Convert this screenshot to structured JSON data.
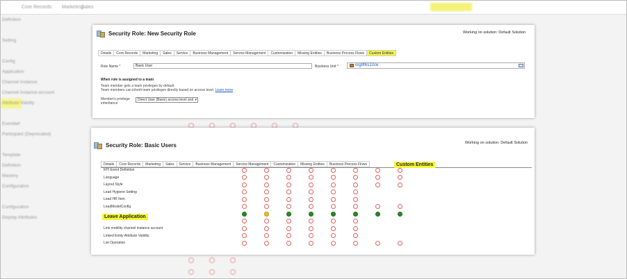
{
  "background": {
    "topbar": [
      "Core Records",
      "Marketing",
      "Sales"
    ],
    "sidebar": [
      "Definition",
      "",
      "Setting",
      "",
      "Config",
      "Application",
      "Channel Instance",
      "Channel Instance account",
      "Attribute Validity",
      "",
      "Eventdef",
      "Participant (Deprecated)",
      "",
      "Template",
      "Definition",
      "Mastery",
      "Configuration",
      "",
      "Configuration",
      "Display Attributes"
    ]
  },
  "panel1": {
    "title": "Security Role: New Security Role",
    "working": "Working on solution: Default Solution",
    "tabs": [
      {
        "label": "Details",
        "hl": false
      },
      {
        "label": "Core Records",
        "hl": false
      },
      {
        "label": "Marketing",
        "hl": false
      },
      {
        "label": "Sales",
        "hl": false
      },
      {
        "label": "Service",
        "hl": false
      },
      {
        "label": "Business Management",
        "hl": false
      },
      {
        "label": "Service Management",
        "hl": false
      },
      {
        "label": "Customization",
        "hl": false
      },
      {
        "label": "Missing Entities",
        "hl": false
      },
      {
        "label": "Business Process Flows",
        "hl": false
      },
      {
        "label": "Custom Entities",
        "hl": true
      }
    ],
    "role_name_label": "Role Name",
    "role_name_value": "Basic User",
    "business_unit_label": "Business Unit",
    "business_unit_value": "org9f6122ce",
    "team_heading": "When role is assigned to a team",
    "team_line1": "Team member gets a team privileges by default.",
    "team_line2": "Team members can inherit team privileges directly based on access level.",
    "learn_more": "Learn more",
    "inherit_label_1": "Member's privilege",
    "inherit_label_2": "inheritance",
    "inherit_value": "Direct User (Basic) access level and"
  },
  "panel2": {
    "title": "Security Role: Basic Users",
    "working": "Working on solution: Default Solution",
    "tabs": [
      "Details",
      "Core Records",
      "Marketing",
      "Sales",
      "Service",
      "Business Management",
      "Service Management",
      "Customization",
      "Missing Entities",
      "Business Process Flows"
    ],
    "rows": [
      {
        "label": "KPI Event Definition",
        "cells": [
          "none",
          "none",
          "none",
          "none",
          "none",
          "none",
          "none",
          "none"
        ]
      },
      {
        "label": "Language",
        "cells": [
          "none",
          "none",
          "none",
          "none",
          "none",
          "none",
          "none",
          "none"
        ]
      },
      {
        "label": "Layout Style",
        "cells": [
          "none",
          "none",
          "none",
          "none",
          "none",
          "none",
          "none",
          "none"
        ]
      },
      {
        "label": "Lead Hygiene Setting",
        "cells": [
          "none",
          "none",
          "none",
          "none",
          "none",
          "none",
          "",
          ""
        ]
      },
      {
        "label": "Lead HR Item",
        "cells": [
          "none",
          "none",
          "none",
          "none",
          "none",
          "none",
          "",
          ""
        ]
      },
      {
        "label": "LeadModelConfig",
        "cells": [
          "none",
          "none",
          "none",
          "none",
          "none",
          "none",
          "none",
          "none"
        ]
      },
      {
        "label": "",
        "cells": [
          "full",
          "user",
          "full",
          "full",
          "full",
          "full",
          "full",
          "full"
        ]
      },
      {
        "label": "",
        "cells": [
          "none",
          "none",
          "none",
          "none",
          "none",
          "none",
          "",
          ""
        ]
      },
      {
        "label": "Link mobility channel instance account",
        "cells": [
          "none",
          "none",
          "none",
          "none",
          "none",
          "none",
          "",
          ""
        ]
      },
      {
        "label": "Linked Entity Attribute Validity",
        "cells": [
          "none",
          "none",
          "none",
          "none",
          "none",
          "none",
          "",
          ""
        ]
      },
      {
        "label": "List Operation",
        "cells": [
          "none",
          "none",
          "none",
          "none",
          "none",
          "none",
          "none",
          "none"
        ]
      }
    ],
    "callout_custom": "Custom Entities",
    "callout_leave": "Leave Application"
  },
  "colors": {
    "highlight": "#f3f34d",
    "full": "#2a8a2a",
    "none": "#e06060",
    "link": "#1a56c8"
  }
}
